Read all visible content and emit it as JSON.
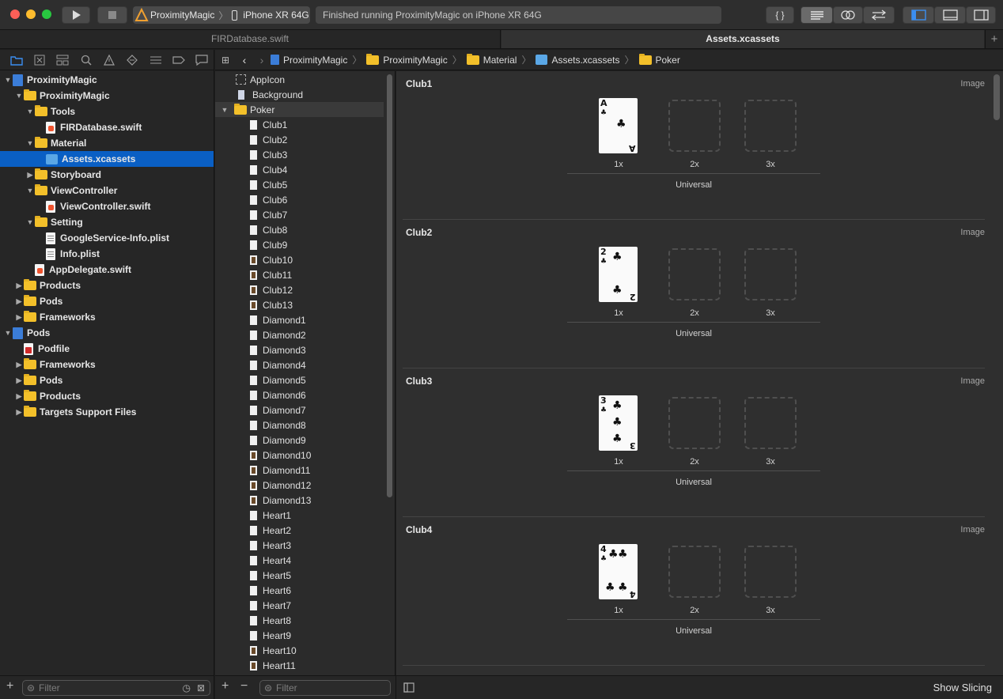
{
  "toolbar": {
    "scheme_name": "ProximityMagic",
    "device_name": "iPhone XR 64G",
    "activity_status": "Finished running ProximityMagic on iPhone XR 64G",
    "code_review_icon": "{ }"
  },
  "tabs": [
    {
      "label": "FIRDatabase.swift"
    },
    {
      "label": "Assets.xcassets"
    }
  ],
  "navigator": {
    "items": [
      {
        "label": "ProximityMagic",
        "icon": "project"
      },
      {
        "label": "ProximityMagic",
        "icon": "folder"
      },
      {
        "label": "Tools",
        "icon": "folder"
      },
      {
        "label": "FIRDatabase.swift",
        "icon": "swift"
      },
      {
        "label": "Material",
        "icon": "folder"
      },
      {
        "label": "Assets.xcassets",
        "icon": "asset"
      },
      {
        "label": "Storyboard",
        "icon": "folder"
      },
      {
        "label": "ViewController",
        "icon": "folder"
      },
      {
        "label": "ViewController.swift",
        "icon": "swift"
      },
      {
        "label": "Setting",
        "icon": "folder"
      },
      {
        "label": "GoogleService-Info.plist",
        "icon": "plist"
      },
      {
        "label": "Info.plist",
        "icon": "plist"
      },
      {
        "label": "AppDelegate.swift",
        "icon": "swift"
      },
      {
        "label": "Products",
        "icon": "folder"
      },
      {
        "label": "Pods",
        "icon": "folder"
      },
      {
        "label": "Frameworks",
        "icon": "folder"
      },
      {
        "label": "Pods",
        "icon": "project"
      },
      {
        "label": "Podfile",
        "icon": "podfile"
      },
      {
        "label": "Frameworks",
        "icon": "folder"
      },
      {
        "label": "Pods",
        "icon": "folder"
      },
      {
        "label": "Products",
        "icon": "folder"
      },
      {
        "label": "Targets Support Files",
        "icon": "folder"
      }
    ],
    "filter_placeholder": "Filter"
  },
  "jumpbar": {
    "crumbs": [
      "ProximityMagic",
      "ProximityMagic",
      "Material",
      "Assets.xcassets",
      "Poker"
    ]
  },
  "asset_list": {
    "items": [
      "AppIcon",
      "Background",
      "Poker",
      "Club1",
      "Club2",
      "Club3",
      "Club4",
      "Club5",
      "Club6",
      "Club7",
      "Club8",
      "Club9",
      "Club10",
      "Club11",
      "Club12",
      "Club13",
      "Diamond1",
      "Diamond2",
      "Diamond3",
      "Diamond4",
      "Diamond5",
      "Diamond6",
      "Diamond7",
      "Diamond8",
      "Diamond9",
      "Diamond10",
      "Diamond11",
      "Diamond12",
      "Diamond13",
      "Heart1",
      "Heart2",
      "Heart3",
      "Heart4",
      "Heart5",
      "Heart6",
      "Heart7",
      "Heart8",
      "Heart9",
      "Heart10",
      "Heart11"
    ],
    "filter_placeholder": "Filter"
  },
  "image_sets": [
    {
      "name": "Club1",
      "type": "Image",
      "rank": "A",
      "suit": "♣"
    },
    {
      "name": "Club2",
      "type": "Image",
      "rank": "2",
      "suit": "♣"
    },
    {
      "name": "Club3",
      "type": "Image",
      "rank": "3",
      "suit": "♣"
    },
    {
      "name": "Club4",
      "type": "Image",
      "rank": "4",
      "suit": "♣"
    }
  ],
  "scales": [
    "1x",
    "2x",
    "3x"
  ],
  "universal_label": "Universal",
  "bottom": {
    "show_slicing": "Show Slicing"
  }
}
